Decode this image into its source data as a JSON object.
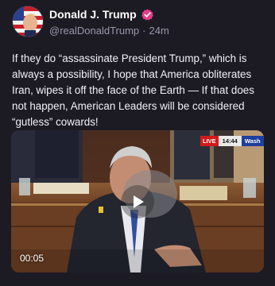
{
  "author": {
    "display_name": "Donald J. Trump",
    "handle": "@realDonaldTrump",
    "separator": "·",
    "time_ago": "24m",
    "verified": true,
    "verified_color": "#e23d8a"
  },
  "post": {
    "text": "If they do “assassinate President Trump,” which is always a possibility, I hope that America obliterates Iran, wipes it off the face of the Earth — If that does not happen, American Leaders will be considered “gutless” cowards!"
  },
  "video": {
    "duration": "00:05",
    "overlay": {
      "live_label": "LIVE",
      "clock": "14:44",
      "network": "Wash"
    },
    "play_icon": "play-icon"
  },
  "colors": {
    "background": "#1c1b24",
    "secondary_text": "#9a98a8"
  }
}
